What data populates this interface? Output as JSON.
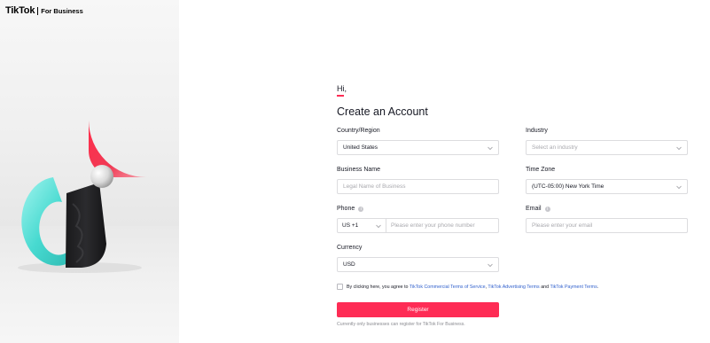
{
  "brand": {
    "name": "TikTok",
    "suffix": "For Business"
  },
  "greeting": "Hi,",
  "title": "Create an Account",
  "fields": {
    "country": {
      "label": "Country/Region",
      "value": "United States"
    },
    "industry": {
      "label": "Industry",
      "placeholder": "Select an industry"
    },
    "business_name": {
      "label": "Business Name",
      "placeholder": "Legal Name of Business"
    },
    "time_zone": {
      "label": "Time Zone",
      "value": "(UTC-05:00) New York Time"
    },
    "phone": {
      "label": "Phone",
      "code": "US +1",
      "placeholder": "Please enter your phone number"
    },
    "email": {
      "label": "Email",
      "placeholder": "Please enter your email"
    },
    "currency": {
      "label": "Currency",
      "value": "USD"
    }
  },
  "consent": {
    "prefix": "By clicking here, you agree to",
    "link1": "TikTok Commercial Terms of Service",
    "sep1": ",",
    "link2": "TikTok Advertising Terms",
    "and": "and",
    "link3": "TikTok Payment Terms",
    "suffix": "."
  },
  "register_label": "Register",
  "note": "Currently only businesses can register for TikTok For Business.",
  "colors": {
    "accent": "#fe2c55",
    "link": "#2f5fcc",
    "cyan": "#25f4ee"
  },
  "icons": [
    "chevron-down-icon",
    "info-icon",
    "tiktok-3d-logo"
  ]
}
